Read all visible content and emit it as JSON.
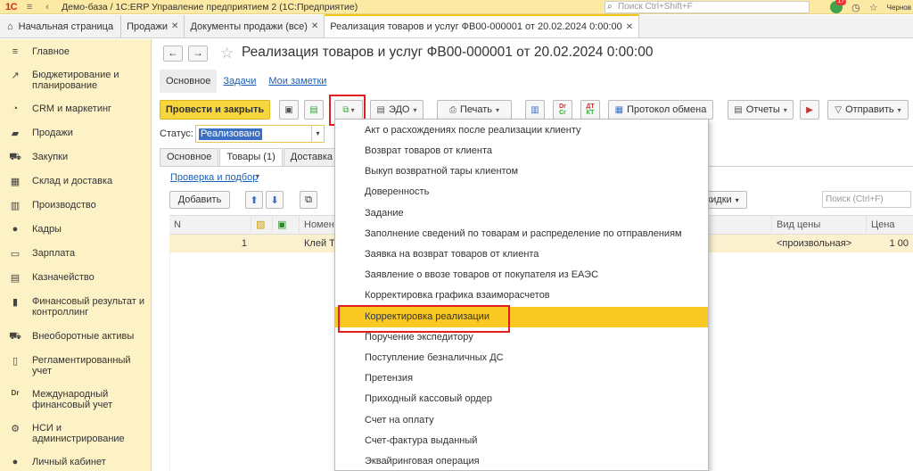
{
  "titlebar": {
    "logo": "1С",
    "title": "Демо-база / 1С:ERP Управление предприятием 2  (1С:Предприятие)",
    "search_placeholder": "Поиск Ctrl+Shift+F",
    "badge": "17",
    "user": "Чернов"
  },
  "tabs": {
    "home": "Начальная страница",
    "items": [
      {
        "label": "Продажи"
      },
      {
        "label": "Документы продажи (все)"
      },
      {
        "label": "Реализация товаров и услуг ФВ00-000001 от 20.02.2024 0:00:00"
      }
    ]
  },
  "sidebar": {
    "items": [
      {
        "label": "Главное",
        "icon": "≡"
      },
      {
        "label": "Бюджетирование и планирование",
        "icon": "↗"
      },
      {
        "label": "CRM и маркетинг",
        "icon": "◔"
      },
      {
        "label": "Продажи",
        "icon": "▰"
      },
      {
        "label": "Закупки",
        "icon": "⛟"
      },
      {
        "label": "Склад и доставка",
        "icon": "▦"
      },
      {
        "label": "Производство",
        "icon": "▥"
      },
      {
        "label": "Кадры",
        "icon": "●"
      },
      {
        "label": "Зарплата",
        "icon": "▭"
      },
      {
        "label": "Казначейство",
        "icon": "▤"
      },
      {
        "label": "Финансовый результат и контроллинг",
        "icon": "▮"
      },
      {
        "label": "Внеоборотные активы",
        "icon": "⛟"
      },
      {
        "label": "Регламентированный учет",
        "icon": "▯"
      },
      {
        "label": "Международный финансовый учет",
        "icon": "Dr"
      },
      {
        "label": "НСИ и администрирование",
        "icon": "⚙"
      },
      {
        "label": "Личный кабинет",
        "icon": "●"
      }
    ]
  },
  "document": {
    "title": "Реализация товаров и услуг ФВ00-000001 от 20.02.2024 0:00:00",
    "subtabs": [
      "Основное",
      "Задачи",
      "Мои заметки"
    ]
  },
  "toolbar": {
    "post_close": "Провести и закрыть",
    "edo": "ЭДО",
    "print": "Печать",
    "exchange_log": "Протокол обмена",
    "reports": "Отчеты",
    "send": "Отправить",
    "mini_dr": "Dr",
    "mini_cr": "Cr",
    "mini_dt": "ДТ",
    "mini_kt": "КТ"
  },
  "status": {
    "label": "Статус:",
    "value": "Реализовано"
  },
  "inner_tabs": [
    "Основное",
    "Товары (1)",
    "Доставка"
  ],
  "goods": {
    "check_link": "Проверка и подбор",
    "add_button": "Добавить",
    "discounts_button": "кидки",
    "search_placeholder": "Поиск (Ctrl+F)",
    "columns": [
      "N",
      "Номен",
      "Вид цены",
      "Цена"
    ],
    "rows": [
      {
        "n": "1",
        "item": "Клей Ti",
        "price_type": "<произвольная>",
        "price": "1 00"
      }
    ]
  },
  "menu": {
    "items": [
      "Акт о расхождениях после реализации клиенту",
      "Возврат товаров от клиента",
      "Выкуп возвратной тары клиентом",
      "Доверенность",
      "Задание",
      "Заполнение сведений по товарам и распределение по отправлениям",
      "Заявка на возврат товаров от клиента",
      "Заявление о ввозе товаров от покупателя из ЕАЭС",
      "Корректировка графика взаиморасчетов",
      "Корректировка реализации",
      "Поручение экспедитору",
      "Поступление безналичных ДС",
      "Претензия",
      "Приходный кассовый ордер",
      "Счет на оплату",
      "Счет-фактура выданный",
      "Эквайринговая операция"
    ],
    "highlighted_index": 9
  }
}
